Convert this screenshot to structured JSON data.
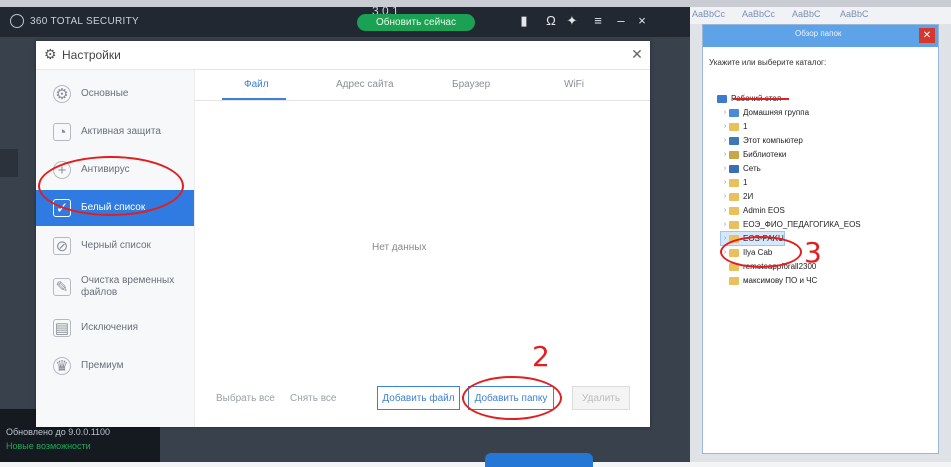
{
  "background_app": {
    "product": "360 TOTAL SECURITY",
    "title_partial": "3.0.1",
    "green_button": "Обновить сейчас",
    "status_line": "Обновлено до 9.0.0.1100",
    "status_link": "Новые возможности"
  },
  "dialog": {
    "title": "Настройки",
    "nav": [
      {
        "label": "Основные",
        "icon": "gear-icon"
      },
      {
        "label": "Активная защита",
        "icon": "shield-icon"
      },
      {
        "label": "Антивирус",
        "icon": "plus-circle-icon"
      },
      {
        "label": "Белый список",
        "icon": "whitelist-icon"
      },
      {
        "label": "Черный список",
        "icon": "blacklist-icon"
      },
      {
        "label": "Очистка временных файлов",
        "icon": "broom-icon"
      },
      {
        "label": "Исключения",
        "icon": "exclusion-icon"
      },
      {
        "label": "Премиум",
        "icon": "premium-icon"
      }
    ],
    "tabs": [
      "Файл",
      "Адрес сайта",
      "Браузер",
      "WiFi"
    ],
    "empty_text": "Нет данных",
    "select_all": "Выбрать все",
    "deselect_all": "Снять все",
    "add_file": "Добавить файл",
    "add_folder": "Добавить папку",
    "delete": "Удалить"
  },
  "explorer": {
    "ribbon_labels": [
      "AaBbCc",
      "AaBbCc",
      "AaBbC",
      "AaBbC"
    ],
    "dialog_caption": "Обзор папок",
    "prompt": "Укажите или выберите каталог:",
    "tree": [
      {
        "label": "Рабочий стол",
        "icon": "desktop-icon",
        "level": 0
      },
      {
        "label": "Домашняя группа",
        "icon": "homegroup-icon",
        "level": 1
      },
      {
        "label": "1",
        "icon": "folder-icon",
        "level": 1
      },
      {
        "label": "Этот компьютер",
        "icon": "computer-icon",
        "level": 1
      },
      {
        "label": "Библиотеки",
        "icon": "library-icon",
        "level": 1
      },
      {
        "label": "Сеть",
        "icon": "network-icon",
        "level": 1
      },
      {
        "label": "1",
        "icon": "folder-icon",
        "level": 1
      },
      {
        "label": "2И",
        "icon": "folder-icon",
        "level": 1
      },
      {
        "label": "Admin EOS",
        "icon": "folder-icon",
        "level": 1
      },
      {
        "label": "ЕОЭ_ФИО_ПЕДАГОГИКА_EOS",
        "icon": "folder-icon",
        "level": 1
      },
      {
        "label": "EOS-PAKU",
        "icon": "folder-icon",
        "level": 1
      },
      {
        "label": "Ilya Cab",
        "icon": "folder-icon",
        "level": 1
      },
      {
        "label": "remoteappforall2300",
        "icon": "folder-icon",
        "level": 1
      },
      {
        "label": "максимову ПО и ЧС",
        "icon": "folder-icon",
        "level": 1
      }
    ]
  },
  "annotations": {
    "number_2": "2",
    "number_3": "3",
    "color": "#e21f1f"
  },
  "accent_color": "#2f7be1"
}
